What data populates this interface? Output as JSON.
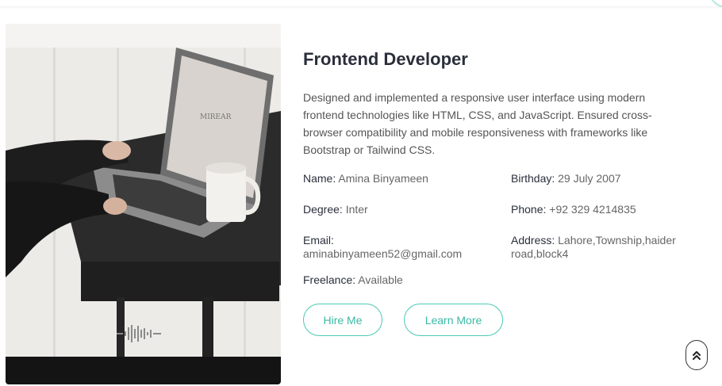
{
  "colors": {
    "accent": "#4cc9b4",
    "title": "#2a2f3b",
    "text": "#555555"
  },
  "photo": {
    "alt": "person typing on laptop beside a coffee mug"
  },
  "about": {
    "title": "Frontend Developer",
    "description": "Designed and implemented a responsive user interface using modern frontend technologies like HTML, CSS, and JavaScript. Ensured cross-browser compatibility and mobile responsiveness with frameworks like Bootstrap or Tailwind CSS.",
    "info": {
      "name_label": "Name:",
      "name_value": " Amina Binyameen",
      "birthday_label": "Birthday:",
      "birthday_value": " 29 July 2007",
      "degree_label": "Degree:",
      "degree_value": " Inter",
      "phone_label": "Phone:",
      "phone_value": " +92 329 4214835",
      "email_label": "Email:",
      "email_value": "aminabinyameen52@gmail.com",
      "address_label": "Address:",
      "address_value": " Lahore,Township,haider road,block4",
      "freelance_label": "Freelance:",
      "freelance_value": " Available"
    },
    "buttons": {
      "hire": "Hire Me",
      "learn": "Learn More"
    }
  },
  "icons": {
    "scroll_top": "double-chevron-up-icon"
  }
}
